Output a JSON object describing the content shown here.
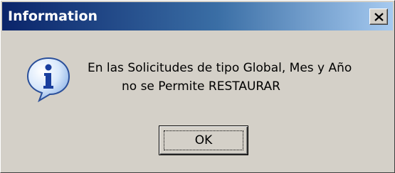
{
  "window": {
    "title": "Information",
    "close_icon": "close-icon"
  },
  "message": {
    "icon": "info-icon",
    "line1": "En las Solicitudes de tipo Global, Mes y Año",
    "line2": "no se Permite RESTAURAR"
  },
  "buttons": {
    "ok_label": "OK"
  },
  "colors": {
    "titlebar_start": "#0a246a",
    "titlebar_end": "#a6caf0",
    "dialog_bg": "#d4d0c8"
  }
}
